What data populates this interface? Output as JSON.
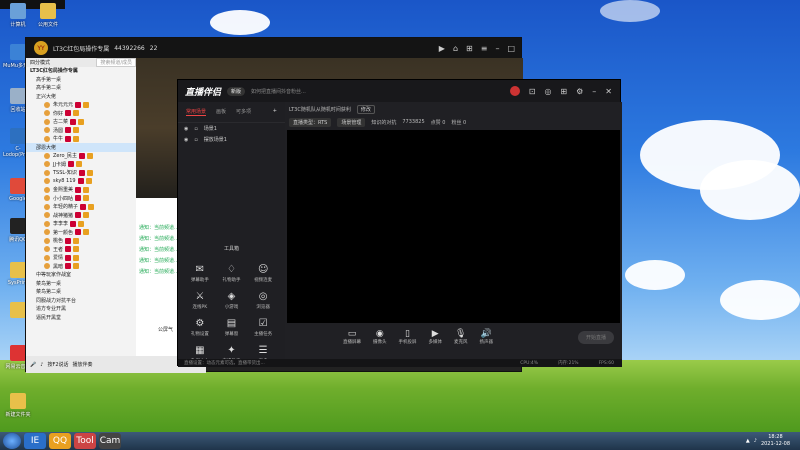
{
  "desktop": {
    "icons": [
      {
        "label": "计算机",
        "color": "#6aa0d8"
      },
      {
        "label": "公用文件",
        "color": "#e8c04a"
      },
      {
        "label": "MuMu多开器",
        "color": "#3b82d6"
      },
      {
        "label": "回收站",
        "color": "#9ab0c8"
      },
      {
        "label": "C-Lodop(Print)",
        "color": "#2d70c0"
      },
      {
        "label": "Google",
        "color": "#e04a3a"
      },
      {
        "label": "腾讯QQ",
        "color": "#222222"
      },
      {
        "label": "SysPrint",
        "color": "#e8c04a"
      },
      {
        "label": "",
        "color": "#e8c04a"
      },
      {
        "label": "网易云音乐",
        "color": "#d33"
      },
      {
        "label": "新建文件夹",
        "color": "#e8c04a"
      }
    ]
  },
  "yy": {
    "title": "LT3C红包局操作专属",
    "channel_id": "44392266",
    "online": "22",
    "mode": "四分模式",
    "search_placeholder": "搜索频道/成员",
    "tree": [
      {
        "t": "LT3C红包局操作专属",
        "c": "top"
      },
      {
        "t": "高手第一桌",
        "c": "ch"
      },
      {
        "t": "高手第二桌",
        "c": "ch"
      },
      {
        "t": "正兴大佬",
        "c": "ch"
      },
      {
        "t": "朱元元元",
        "c": "u"
      },
      {
        "t": "你好",
        "c": "u"
      },
      {
        "t": "古二菜",
        "c": "u"
      },
      {
        "t": "汤圆",
        "c": "u"
      },
      {
        "t": "牛牛",
        "c": "u"
      },
      {
        "t": "邵恩大佬",
        "c": "hl"
      },
      {
        "t": "Zero_民主",
        "c": "u"
      },
      {
        "t": "JJ卡姆",
        "c": "u"
      },
      {
        "t": "TSSL-知识",
        "c": "u"
      },
      {
        "t": "sky8 119",
        "c": "u"
      },
      {
        "t": "金熙重美",
        "c": "u"
      },
      {
        "t": "小小四咕",
        "c": "u"
      },
      {
        "t": "年轻的精子",
        "c": "u"
      },
      {
        "t": "战神猪猪",
        "c": "u"
      },
      {
        "t": "李李李",
        "c": "u"
      },
      {
        "t": "第一颜色",
        "c": "u"
      },
      {
        "t": "桃色",
        "c": "u"
      },
      {
        "t": "王者",
        "c": "u"
      },
      {
        "t": "爱情",
        "c": "u"
      },
      {
        "t": "黑暗",
        "c": "u"
      },
      {
        "t": "中等玩家作战室",
        "c": "ch"
      },
      {
        "t": "菜鸟第一桌",
        "c": "ch"
      },
      {
        "t": "菜鸟第二桌",
        "c": "ch"
      },
      {
        "t": "同服战力对抗平台",
        "c": "ch"
      },
      {
        "t": "追方专业开黑",
        "c": "ch"
      },
      {
        "t": "逼民开黑堂",
        "c": "ch"
      }
    ],
    "chat": [
      "通知：当前频道...",
      "通知：当前频道...",
      "通知：当前频道...",
      "通知：当前频道...",
      "通知：当前频道..."
    ],
    "mic_label": "公屏气",
    "bottom": [
      "按F2说话",
      "播放伴奏"
    ]
  },
  "zb": {
    "logo": "直播伴侣",
    "version": "新版",
    "notice": "如何把直播间抖音粉丝...",
    "tabs": [
      "常用场景",
      "画板",
      "可多项"
    ],
    "scenes": [
      "场景1",
      "摆放场景1"
    ],
    "tools_title": "工具箱",
    "tools": [
      {
        "label": "弹幕助手",
        "icon": "✉"
      },
      {
        "label": "礼物助手",
        "icon": "♢"
      },
      {
        "label": "视频连麦",
        "icon": "☺"
      },
      {
        "label": "连线PK",
        "icon": "⚔"
      },
      {
        "label": "小游戏",
        "icon": "◈"
      },
      {
        "label": "浏览器",
        "icon": "◎"
      },
      {
        "label": "礼物设置",
        "icon": "⚙"
      },
      {
        "label": "弹幕窗",
        "icon": "▤"
      },
      {
        "label": "主播任务",
        "icon": "☑"
      },
      {
        "label": "数据中心",
        "icon": "▦"
      },
      {
        "label": "直播助手",
        "icon": "✦"
      },
      {
        "label": "更多",
        "icon": "☰"
      }
    ],
    "room_title": "LT3C随机队从随机时间获利",
    "room_tag": "修改",
    "sub_items": [
      "直播类型：RTS",
      "场景管理",
      "知识的对抗",
      "7733825",
      "点赞 0",
      "粉丝 0"
    ],
    "bottom_tools": [
      {
        "label": "直播屏幕",
        "icon": "▭"
      },
      {
        "label": "摄像头",
        "icon": "◉"
      },
      {
        "label": "手机投屏",
        "icon": "▯"
      },
      {
        "label": "多媒体",
        "icon": "▶"
      },
      {
        "label": "麦克风",
        "icon": "🎙"
      },
      {
        "label": "扬声器",
        "icon": "🔊"
      }
    ],
    "go_live": "开始直播",
    "status": [
      "直播设置：动态元素可选，直播带货出...",
      "CPU:4%",
      "内存:21%",
      "FPS:60"
    ]
  },
  "taskbar": {
    "apps": [
      "IE",
      "QQ",
      "Tool",
      "Cam"
    ],
    "time": "18:28",
    "date": "2021-12-08"
  }
}
